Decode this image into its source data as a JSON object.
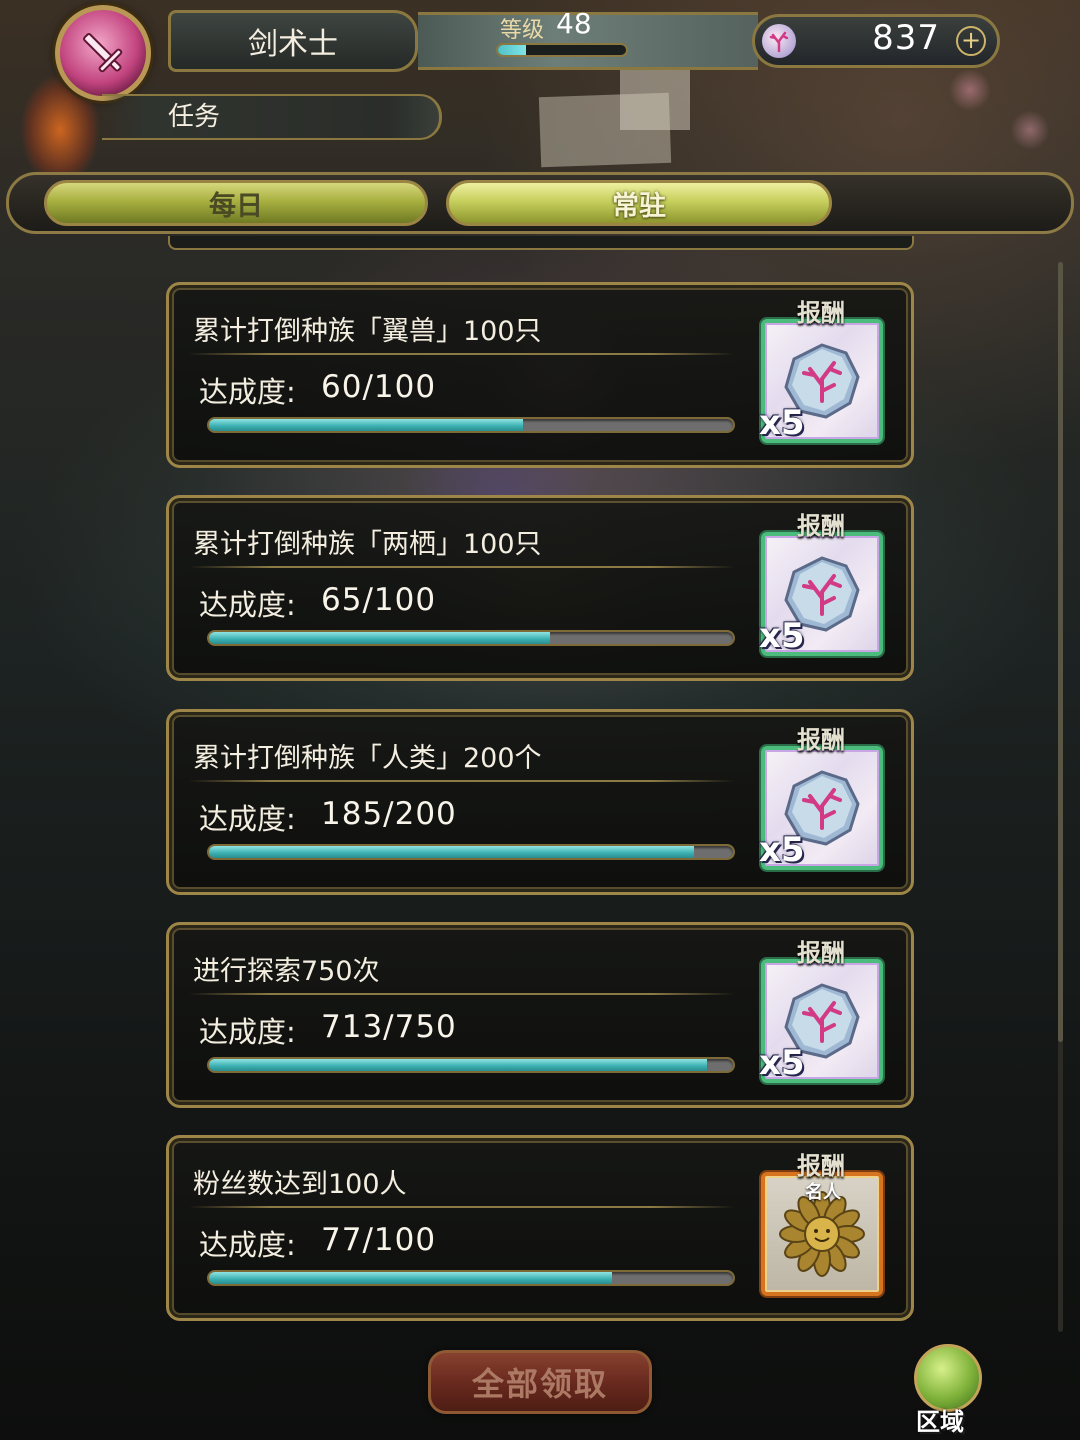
{
  "header": {
    "class_name": "剑术士",
    "level_label": "等级",
    "level_value": "48",
    "level_progress": 0.22,
    "gem_count": "837",
    "section_title": "任务"
  },
  "tabs": [
    {
      "label": "每日",
      "active": false
    },
    {
      "label": "常驻",
      "active": true
    }
  ],
  "quests": [
    {
      "title": "累计打倒种族「翼兽」100只",
      "progress_label": "达成度:",
      "progress_text": "60/100",
      "progress": 0.6,
      "reward_label": "报酬",
      "reward_count": "x5",
      "reward_icon": "coral-crystal-icon"
    },
    {
      "title": "累计打倒种族「两栖」100只",
      "progress_label": "达成度:",
      "progress_text": "65/100",
      "progress": 0.65,
      "reward_label": "报酬",
      "reward_count": "x5",
      "reward_icon": "coral-crystal-icon"
    },
    {
      "title": "累计打倒种族「人类」200个",
      "progress_label": "达成度:",
      "progress_text": "185/200",
      "progress": 0.925,
      "reward_label": "报酬",
      "reward_count": "x5",
      "reward_icon": "coral-crystal-icon"
    },
    {
      "title": "进行探索750次",
      "progress_label": "达成度:",
      "progress_text": "713/750",
      "progress": 0.951,
      "reward_label": "报酬",
      "reward_count": "x5",
      "reward_icon": "coral-crystal-icon"
    },
    {
      "title": "粉丝数达到100人",
      "progress_label": "达成度:",
      "progress_text": "77/100",
      "progress": 0.77,
      "reward_label": "报酬",
      "reward_sub": "名人",
      "reward_icon": "sunflower-medal-icon"
    }
  ],
  "footer": {
    "claim_all_label": "全部领取",
    "region_label": "区域"
  },
  "colors": {
    "accent_gold": "#9d8648",
    "progress_teal": "#3aaeb0",
    "tab_green": "#a8b040",
    "claim_red": "#7a2f22"
  }
}
